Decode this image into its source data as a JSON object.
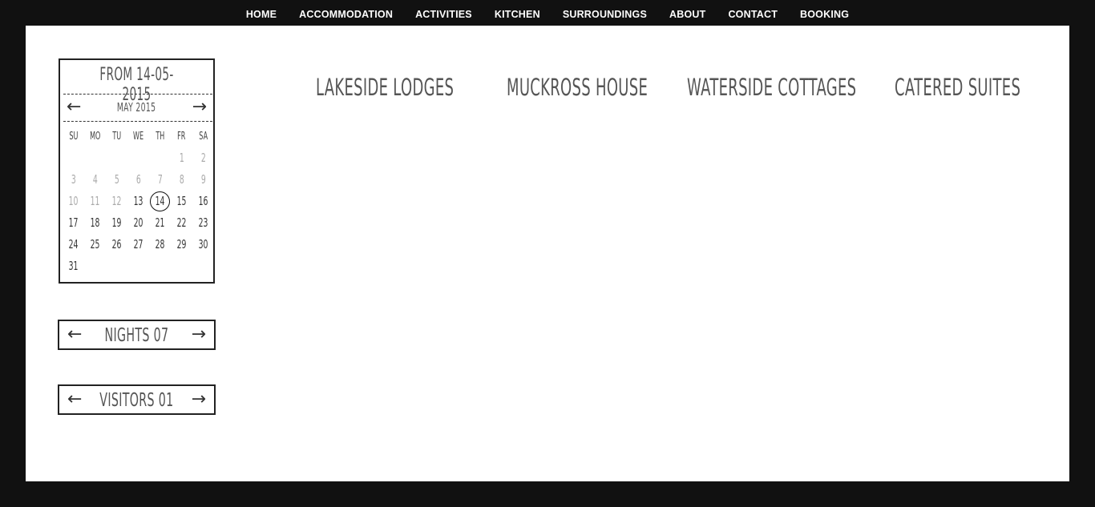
{
  "nav": {
    "items": [
      "HOME",
      "ACCOMMODATION",
      "ACTIVITIES",
      "KITCHEN",
      "SURROUNDINGS",
      "ABOUT",
      "CONTACT",
      "BOOKING"
    ]
  },
  "calendar": {
    "title": "FROM 14-05-2015",
    "month": "MAY 2015",
    "prev_icon": "arrow-left-icon",
    "next_icon": "arrow-right-icon",
    "weekdays": [
      "SU",
      "MO",
      "TU",
      "WE",
      "TH",
      "FR",
      "SA"
    ],
    "days": [
      "",
      "",
      "",
      "",
      "",
      "1",
      "2",
      "3",
      "4",
      "5",
      "6",
      "7",
      "8",
      "9",
      "10",
      "11",
      "12",
      "13",
      "14",
      "15",
      "16",
      "17",
      "18",
      "19",
      "20",
      "21",
      "22",
      "23",
      "24",
      "25",
      "26",
      "27",
      "28",
      "29",
      "30",
      "31"
    ],
    "selected": "14",
    "disabled_through": 12
  },
  "nights": {
    "label": "NIGHTS 07"
  },
  "visitors": {
    "label": "VISITORS 01"
  },
  "categories": [
    "LAKESIDE LODGES",
    "MUCKROSS HOUSE",
    "WATERSIDE COTTAGES",
    "CATERED SUITES"
  ],
  "colors": {
    "frame": "#111111",
    "panel": "#ffffff",
    "ink": "#333333"
  }
}
